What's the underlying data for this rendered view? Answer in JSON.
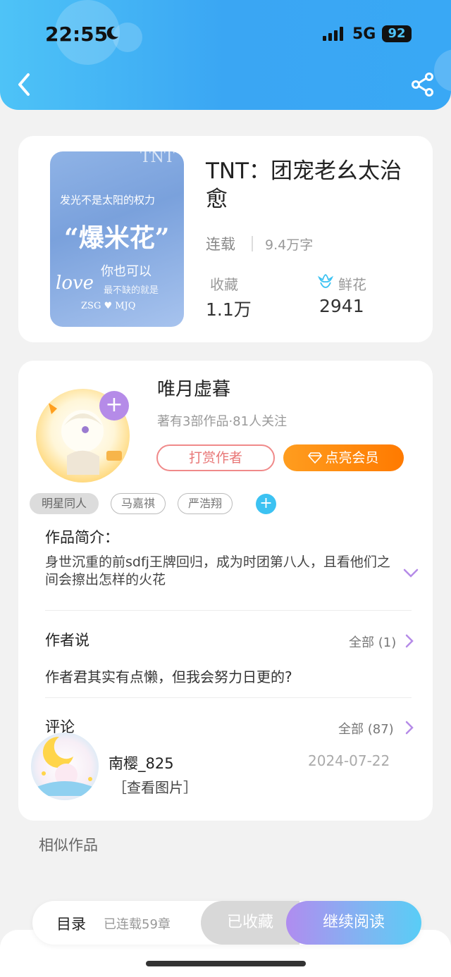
{
  "status_bar": {
    "time": "22:55",
    "network": "5G",
    "battery": "92"
  },
  "book": {
    "title": "TNT：团宠老幺太治愈",
    "status": "连载",
    "word_count": "9.4万字",
    "stats": [
      {
        "label": "收藏",
        "value": "1.1万"
      },
      {
        "label": "鲜花",
        "value": "2941"
      }
    ],
    "cover_text": [
      "发光不是太阳的权力",
      "“爆米花”",
      "你也可以",
      "love",
      "最不缺的就是",
      "ZSG ♥ MJQ",
      "TNT"
    ]
  },
  "author": {
    "name": "唯月虚暮",
    "meta": "著有3部作品·81人关注",
    "tip_label": "打赏作者",
    "vip_label": "点亮会员",
    "tags": [
      "明星同人",
      "马嘉祺",
      "严浩翔"
    ]
  },
  "intro": {
    "title": "作品简介：",
    "text": "身世沉重的前sdfj王牌回归，成为时团第八人，且看他们之间会擦出怎样的火花"
  },
  "author_says": {
    "title": "作者说",
    "all_label": "全部 (1)",
    "text": "作者君其实有点懒，但我会努力日更的?"
  },
  "comments": {
    "title": "评论",
    "all_label": "全部 (87)",
    "items": [
      {
        "user": "南樱_825",
        "date": "2024-07-22",
        "content": "［查看图片］"
      }
    ]
  },
  "similar_title": "相似作品",
  "bottom_bar": {
    "toc_label": "目录",
    "chapters": "已连载59章",
    "collected_label": "已收藏",
    "read_label": "继续阅读"
  },
  "colors": {
    "header_gradient_start": "#4ec3f7",
    "accent_blue": "#3cc2f2",
    "vip_orange": "#ff8a00",
    "tip_pink": "#f08a8a",
    "follow_purple": "#b58be8"
  }
}
